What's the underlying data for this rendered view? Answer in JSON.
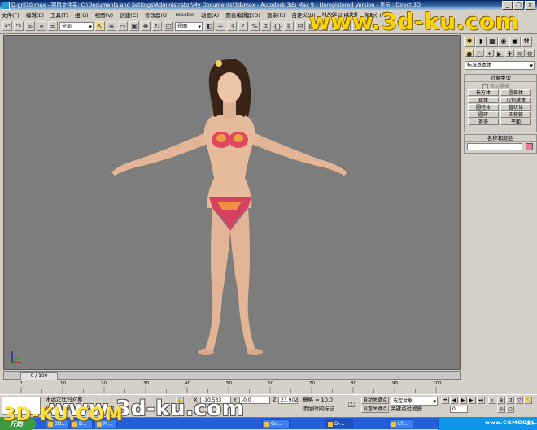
{
  "window": {
    "title": "D-gril10.max  -  项目文件夹: C:\\Documents and Settings\\Administrator\\My Documents\\3dsmax  -  Autodesk 3ds Max 9  -  Unregistered Version  -  显示 : Direct 3D",
    "min": "_",
    "max": "□",
    "close": "×"
  },
  "menu": [
    "文件(F)",
    "编辑(E)",
    "工具(T)",
    "组(G)",
    "视图(V)",
    "创建(C)",
    "修改器(O)",
    "reactor",
    "动画(A)",
    "图表编辑器(D)",
    "渲染(R)",
    "自定义(U)",
    "MAXScript(M)",
    "帮助(H)"
  ],
  "toolbar": {
    "selection_filter": "全部",
    "ref_coord": "视图",
    "icons_left": [
      "undo-icon",
      "redo-icon",
      "link-icon",
      "unlink-icon",
      "bind-space-warp-icon"
    ],
    "icons_select": [
      "select-icon",
      "select-by-name-icon",
      "rect-select-icon",
      "window-crossing-icon"
    ],
    "icons_transform": [
      "move-icon",
      "rotate-icon",
      "scale-icon"
    ],
    "icons_right": [
      "pivot-icon",
      "select-manipulate-icon",
      "snap-icon",
      "angle-snap-icon",
      "percent-snap-icon",
      "spinner-snap-icon",
      "named-sets-icon",
      "mirror-icon",
      "align-icon",
      "layer-icon",
      "curve-editor-icon",
      "schematic-icon",
      "material-editor-icon",
      "render-scene-icon",
      "quick-render-icon"
    ]
  },
  "command_panel": {
    "tabs": [
      "create-tab",
      "modify-tab",
      "hierarchy-tab",
      "motion-tab",
      "display-tab",
      "utilities-tab"
    ],
    "subcategory_icons": [
      "geometry-icon",
      "shapes-icon",
      "lights-icon",
      "cameras-icon",
      "helpers-icon",
      "space-warps-icon",
      "systems-icon"
    ],
    "dropdown": "标准基本体",
    "object_type": {
      "header": "对象类型",
      "autogrid": "自动栅格",
      "buttons": [
        "长方体",
        "圆锥体",
        "球体",
        "几何球体",
        "圆柱体",
        "管状体",
        "圆环",
        "四棱锥",
        "茶壶",
        "平面"
      ]
    },
    "name_color": {
      "header": "名称和颜色",
      "name_value": "",
      "color": "#e87890"
    }
  },
  "timeline": {
    "frame_label": "0 / 100"
  },
  "ruler": {
    "ticks": [
      "0",
      "10",
      "20",
      "30",
      "40",
      "50",
      "60",
      "70",
      "80",
      "90",
      "100"
    ]
  },
  "status": {
    "selection": "未选定任何对象",
    "prompt": "单击并拖动以选择并移动对象",
    "x_label": "X",
    "x_value": "-10.533",
    "y_label": "Y",
    "y_value": "-0.0",
    "z_label": "Z",
    "z_value": "23.902",
    "grid_label": "栅格 = 10.0",
    "autokey": "自动关键点",
    "setkey": "设置关键点",
    "add_time_tag": "添加时间标记",
    "key_filters": "关键点过滤器...",
    "key_mode_dropdown": "选定对象",
    "frame_value": "0"
  },
  "taskbar": {
    "start": "开始",
    "tasks": [
      "3D...",
      "B...",
      "M...",
      "Go...",
      "D-...",
      "",
      "LP...",
      "",
      "",
      "",
      "",
      "",
      "",
      ""
    ],
    "tray_text": "CH"
  },
  "watermarks": {
    "top": "www.3d-ku.com",
    "bottom": "www.3d-ku.com",
    "corner": "3D-KU.COM",
    "site": "www.CGMODEL.cn"
  }
}
